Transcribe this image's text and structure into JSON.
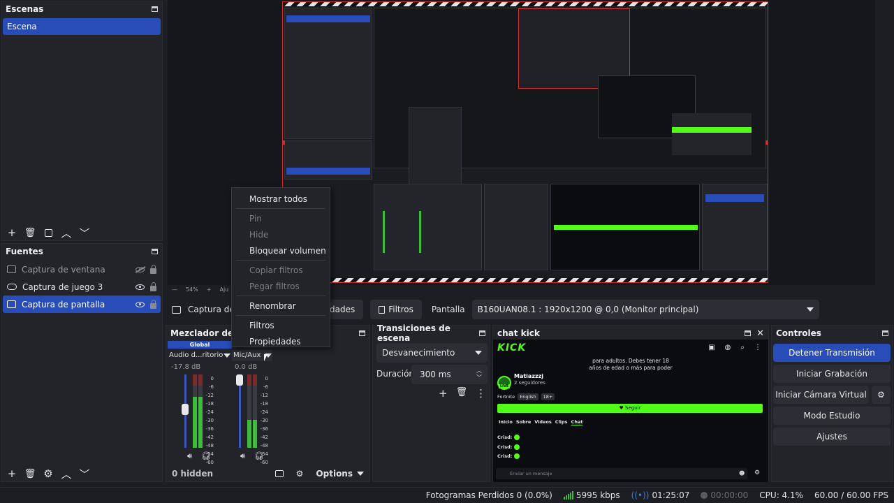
{
  "scenes": {
    "title": "Escenas",
    "items": [
      {
        "label": "Escena",
        "selected": true
      }
    ]
  },
  "sources": {
    "title": "Fuentes",
    "items": [
      {
        "label": "Captura de ventana",
        "icon": "window-icon",
        "visible": false,
        "locked": true
      },
      {
        "label": "Captura de juego 3",
        "icon": "gamepad-icon",
        "visible": true,
        "locked": true
      },
      {
        "label": "Captura de pantalla",
        "icon": "monitor-icon",
        "visible": true,
        "locked": true,
        "selected": true
      }
    ]
  },
  "preview": {
    "zoom": "54%",
    "zoom_suffix": "Aju"
  },
  "context_bar": {
    "source_label": "Captura de p",
    "properties": "dades",
    "filters": "Filtros",
    "display_label": "Pantalla",
    "display_value": "B160UAN08.1 : 1920x1200 @ 0,0 (Monitor principal)"
  },
  "mixer": {
    "title": "Mezclador de au",
    "global_label": "Global",
    "channels": [
      {
        "name": "Audio d...ritorio",
        "db": "-17.8 dB"
      },
      {
        "name": "Mic/Aux",
        "db": "0.0 dB"
      }
    ],
    "scale": [
      "0",
      "-6",
      "-12",
      "-18",
      "-24",
      "-30",
      "-36",
      "-42",
      "-48",
      "-54",
      "-60"
    ],
    "hidden": "0 hidden",
    "options": "Options"
  },
  "transitions": {
    "title": "Transiciones de escena",
    "type": "Desvanecimiento",
    "duration_label": "Duración",
    "duration_value": "300 ms"
  },
  "chat": {
    "title": "chat kick",
    "logo": "KICK",
    "notice1": "para adultos. Debes tener 18",
    "notice2": "años de edad o más para poder",
    "streamer": "Matiazzzj",
    "followers": "2 seguidores",
    "live": "LIVE",
    "tags": [
      "Fortnite",
      "English",
      "18+"
    ],
    "follow_button": "♥ Seguir",
    "tabs": [
      "Inicio",
      "Sobre",
      "Videos",
      "Clips",
      "Chat"
    ],
    "messages": [
      "Crisd:",
      "Crisd:",
      "Crisd:"
    ],
    "input_placeholder": "Enviar un mensaje"
  },
  "controls": {
    "title": "Controles",
    "buttons": [
      "Detener Transmisión",
      "Iniciar Grabación",
      "Iniciar Cámara Virtual",
      "Modo Estudio",
      "Ajustes"
    ]
  },
  "context_menu": {
    "items": [
      {
        "label": "Mostrar todos",
        "enabled": true
      },
      {
        "sep": true
      },
      {
        "label": "Pin",
        "enabled": false
      },
      {
        "label": "Hide",
        "enabled": false
      },
      {
        "label": "Bloquear volumen",
        "enabled": true
      },
      {
        "sep": true
      },
      {
        "label": "Copiar filtros",
        "enabled": false
      },
      {
        "label": "Pegar filtros",
        "enabled": false
      },
      {
        "sep": true
      },
      {
        "label": "Renombrar",
        "enabled": true
      },
      {
        "sep": true
      },
      {
        "label": "Filtros",
        "enabled": true
      },
      {
        "label": "Propiedades",
        "enabled": true
      }
    ]
  },
  "status": {
    "dropped_frames": "Fotogramas Perdidos 0 (0.0%)",
    "bitrate": "5995 kbps",
    "stream_time": "01:25:07",
    "rec_time": "00:00:00",
    "cpu": "CPU: 4.1%",
    "fps": "60.00 / 60.00 FPS"
  },
  "colors": {
    "accent": "#284cb8",
    "live_red": "#d42b2b",
    "kick_green": "#53fc18",
    "meter_green": "#3dbb3d"
  }
}
